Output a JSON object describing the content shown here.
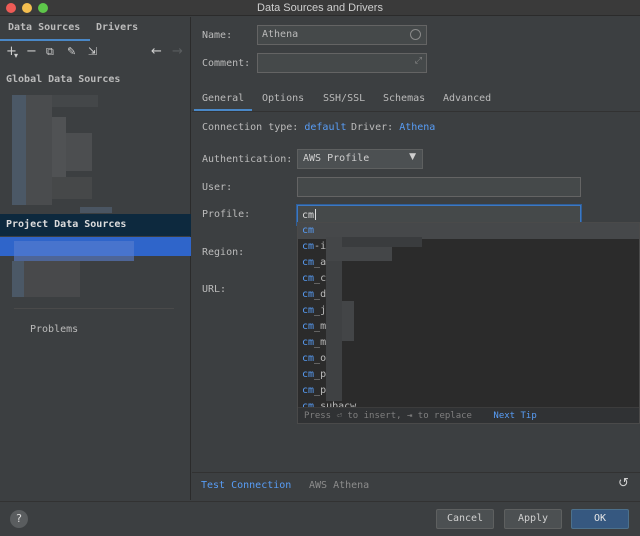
{
  "window": {
    "title": "Data Sources and Drivers"
  },
  "left": {
    "tabs": [
      "Data Sources",
      "Drivers"
    ],
    "toolbar": {
      "add": "+",
      "dropdown": "▾",
      "remove": "−",
      "copy": "⧉",
      "settings": "✎",
      "import": "⇲",
      "back": "←",
      "forward": "→"
    },
    "global_label": "Global Data Sources",
    "project_label": "Project Data Sources",
    "problems_label": "Problems"
  },
  "form": {
    "name_label": "Name:",
    "name_value": "Athena",
    "comment_label": "Comment:",
    "comment_value": "",
    "tabs": [
      "General",
      "Options",
      "SSH/SSL",
      "Schemas",
      "Advanced"
    ],
    "connection_type_label": "Connection type:",
    "connection_type_value": "default",
    "driver_label": "Driver:",
    "driver_value": "Athena",
    "auth_label": "Authentication:",
    "auth_value": "AWS Profile",
    "user_label": "User:",
    "user_value": "",
    "profile_label": "Profile:",
    "profile_value": "cm",
    "region_label": "Region:",
    "url_label": "URL:"
  },
  "popup": {
    "match": "cm",
    "items": [
      {
        "match": "cm",
        "rest": ""
      },
      {
        "match": "cm",
        "rest": "-i"
      },
      {
        "match": "cm",
        "rest": "_a"
      },
      {
        "match": "cm",
        "rest": "_c"
      },
      {
        "match": "cm",
        "rest": "_d"
      },
      {
        "match": "cm",
        "rest": "_j"
      },
      {
        "match": "cm",
        "rest": "_m"
      },
      {
        "match": "cm",
        "rest": "_m"
      },
      {
        "match": "cm",
        "rest": "_o"
      },
      {
        "match": "cm",
        "rest": "_p"
      },
      {
        "match": "cm",
        "rest": "_p"
      },
      {
        "match": "cm",
        "rest": "_subacw"
      }
    ],
    "hint": "Press ⏎ to insert, ⇥ to replace",
    "next_tip": "Next Tip"
  },
  "footer_links": {
    "test_connection": "Test Connection",
    "driver_name": "AWS Athena",
    "reset": "↺"
  },
  "buttons": {
    "help": "?",
    "cancel": "Cancel",
    "apply": "Apply",
    "ok": "OK"
  },
  "colors": {
    "accent": "#589df6",
    "selection": "#2f65ca",
    "primary_button": "#365880"
  }
}
